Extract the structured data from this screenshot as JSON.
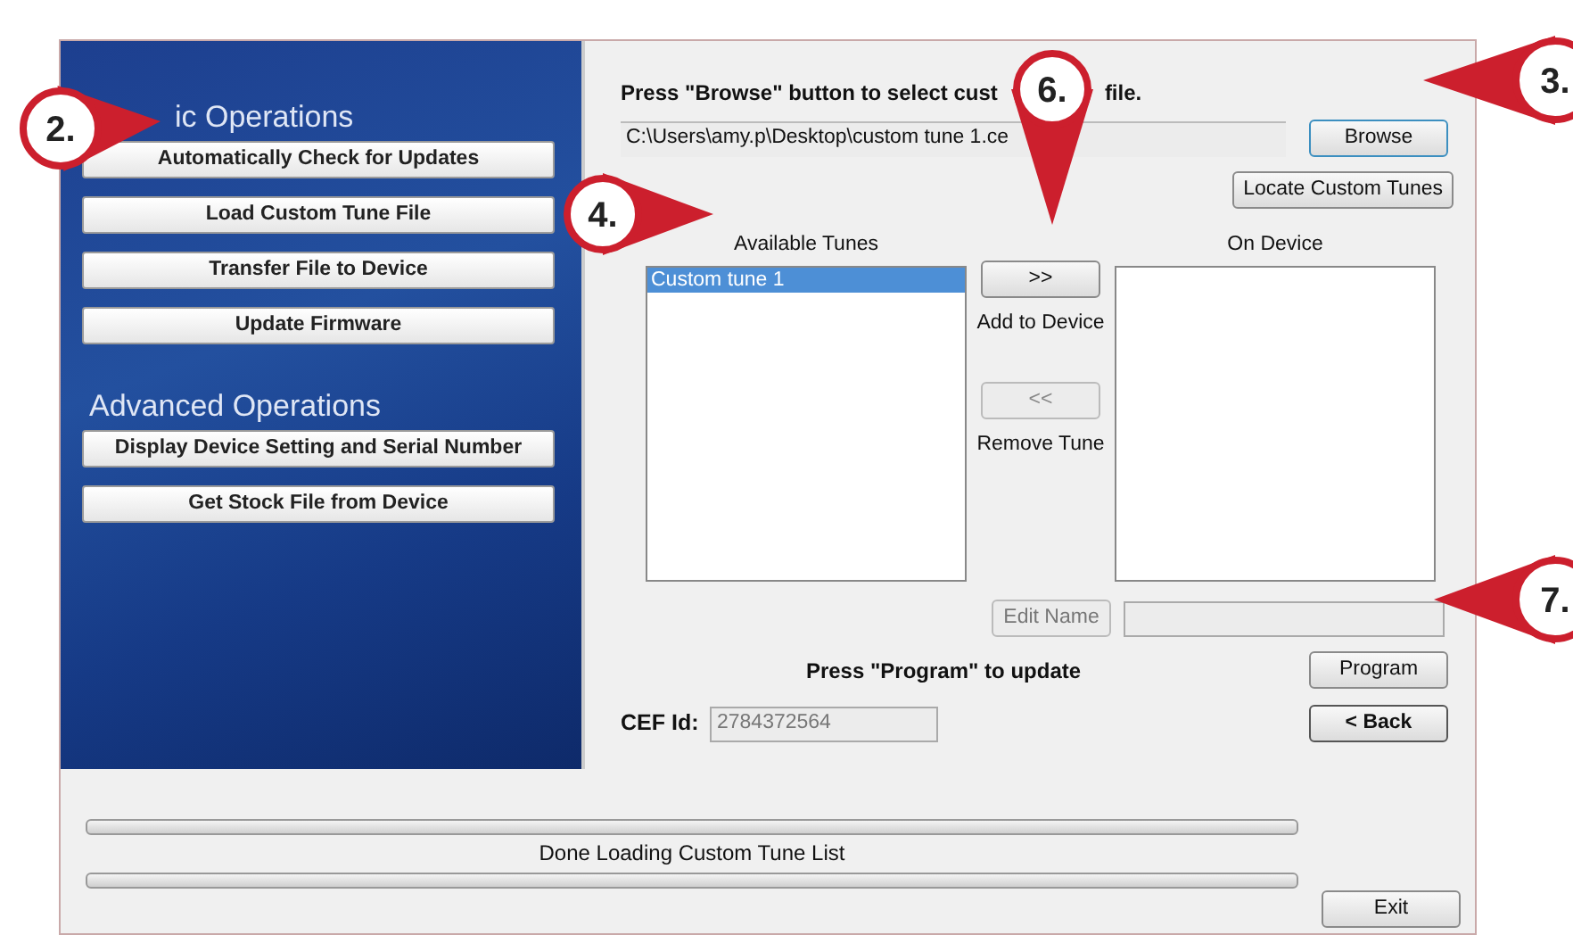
{
  "sidebar": {
    "sections": [
      {
        "title": "ic Operations",
        "buttons": [
          "Automatically Check for Updates",
          "Load Custom Tune File",
          "Transfer File to Device",
          "Update Firmware"
        ]
      },
      {
        "title": "Advanced Operations",
        "buttons": [
          "Display Device Setting and Serial Number",
          "Get Stock File from Device"
        ]
      }
    ]
  },
  "main": {
    "instruction_parts": [
      "Press \"Browse\" button to select cust",
      "file."
    ],
    "file_path": "C:\\Users\\amy.p\\Desktop\\custom tune 1.ce",
    "browse_button": "Browse",
    "locate_button": "Locate Custom Tunes",
    "available": {
      "label": "Available Tunes",
      "items": [
        {
          "text": "Custom tune 1",
          "selected": true
        }
      ]
    },
    "on_device": {
      "label": "On Device"
    },
    "transfer": [
      {
        "symbol": ">>",
        "caption": "Add to Device",
        "disabled": false
      },
      {
        "symbol": "<<",
        "caption": "Remove Tune",
        "disabled": true
      }
    ],
    "edit_name": {
      "label": "Edit Name",
      "disabled": true
    },
    "name_field": {
      "disabled": true
    },
    "program_hint": "Press \"Program\" to update",
    "program_button": "Program",
    "cef": {
      "label": "CEF Id:",
      "value": "2784372564"
    },
    "back_button": "< Back"
  },
  "status": {
    "progress": [
      {
        "level": 0
      },
      {
        "level": 0
      }
    ],
    "message": "Done Loading Custom Tune List",
    "exit_button": "Exit"
  },
  "callouts": [
    {
      "number": "6."
    },
    {
      "number": "3."
    },
    {
      "number": "2."
    },
    {
      "number": "4."
    },
    {
      "number": "7."
    }
  ]
}
